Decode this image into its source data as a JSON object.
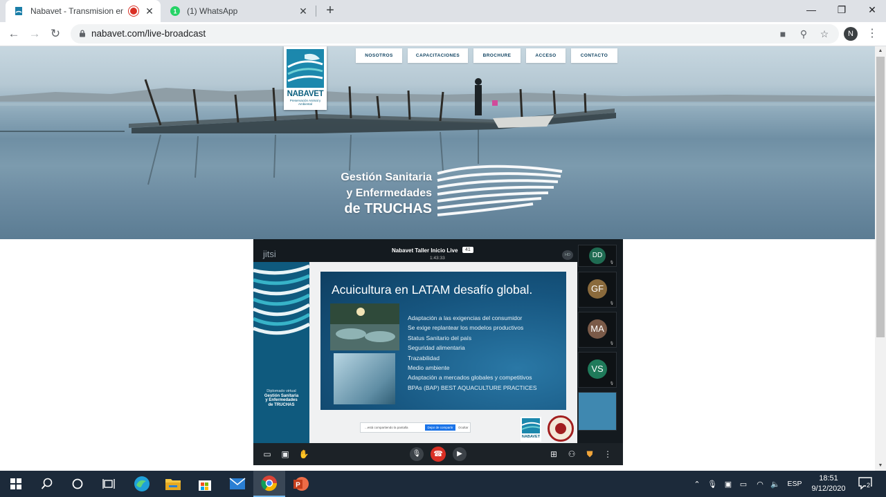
{
  "browser": {
    "tabs": [
      {
        "title": "Nabavet - Transmision en Vivo",
        "recording": true,
        "active": true
      },
      {
        "title": "(1) WhatsApp",
        "badge": "1",
        "active": false
      }
    ],
    "new_tab_label": "+",
    "url": "nabavet.com/live-broadcast",
    "profile_initial": "N"
  },
  "site": {
    "logo_name": "NABAVET",
    "logo_tagline": "Preservación Animal y Ambiental",
    "nav": [
      "NOSOTROS",
      "CAPACITACIONES",
      "BROCHURE",
      "ACCESO",
      "CONTACTO"
    ],
    "hero_title": [
      "Gestión Sanitaria",
      "y Enfermedades",
      "de TRUCHAS"
    ]
  },
  "meeting": {
    "app_name": "jitsi",
    "title": "Nabavet Taller Inicio Live",
    "participant_count": "41",
    "elapsed": "1:43:33",
    "quality": "HD",
    "participants": [
      {
        "initials": "DD",
        "color": "#1f6b52"
      },
      {
        "initials": "GF",
        "color": "#8a6a3c"
      },
      {
        "initials": "MA",
        "color": "#7a5a48"
      },
      {
        "initials": "VS",
        "color": "#1f7a5a"
      }
    ],
    "share_bar": {
      "text": "...está compartiendo la pantalla",
      "stop": "Dejar de compartir",
      "hide": "Ocultar"
    }
  },
  "slide": {
    "title": "Acuicultura en LATAM desafío global.",
    "bullets": [
      "Adaptación a las exigencias del consumidor",
      "Se exige replantear los modelos productivos",
      "Status Sanitario del país",
      "Seguridad alimentaria",
      "Trazabilidad",
      "Medio ambiente",
      "Adaptación a mercados globales y competitivos",
      "BPAs (BAP) BEST AQUACULTURE PRACTICES"
    ],
    "sidebar_caption": [
      "Diplomado virtual",
      "Gestión Sanitaria",
      "y Enfermedades",
      "de TRUCHAS"
    ],
    "footer_logo": "NABAVET"
  },
  "taskbar": {
    "apps": [
      "start",
      "search",
      "cortana",
      "task-view",
      "edge",
      "file-explorer",
      "store",
      "mail",
      "chrome",
      "powerpoint"
    ],
    "language": "ESP",
    "time": "18:51",
    "date": "9/12/2020",
    "notification_count": "2"
  },
  "colors": {
    "brand": "#0b5f7e",
    "hangup": "#d93025",
    "chrome_tab_bg": "#dee1e6",
    "taskbar": "#1c2a3a"
  }
}
